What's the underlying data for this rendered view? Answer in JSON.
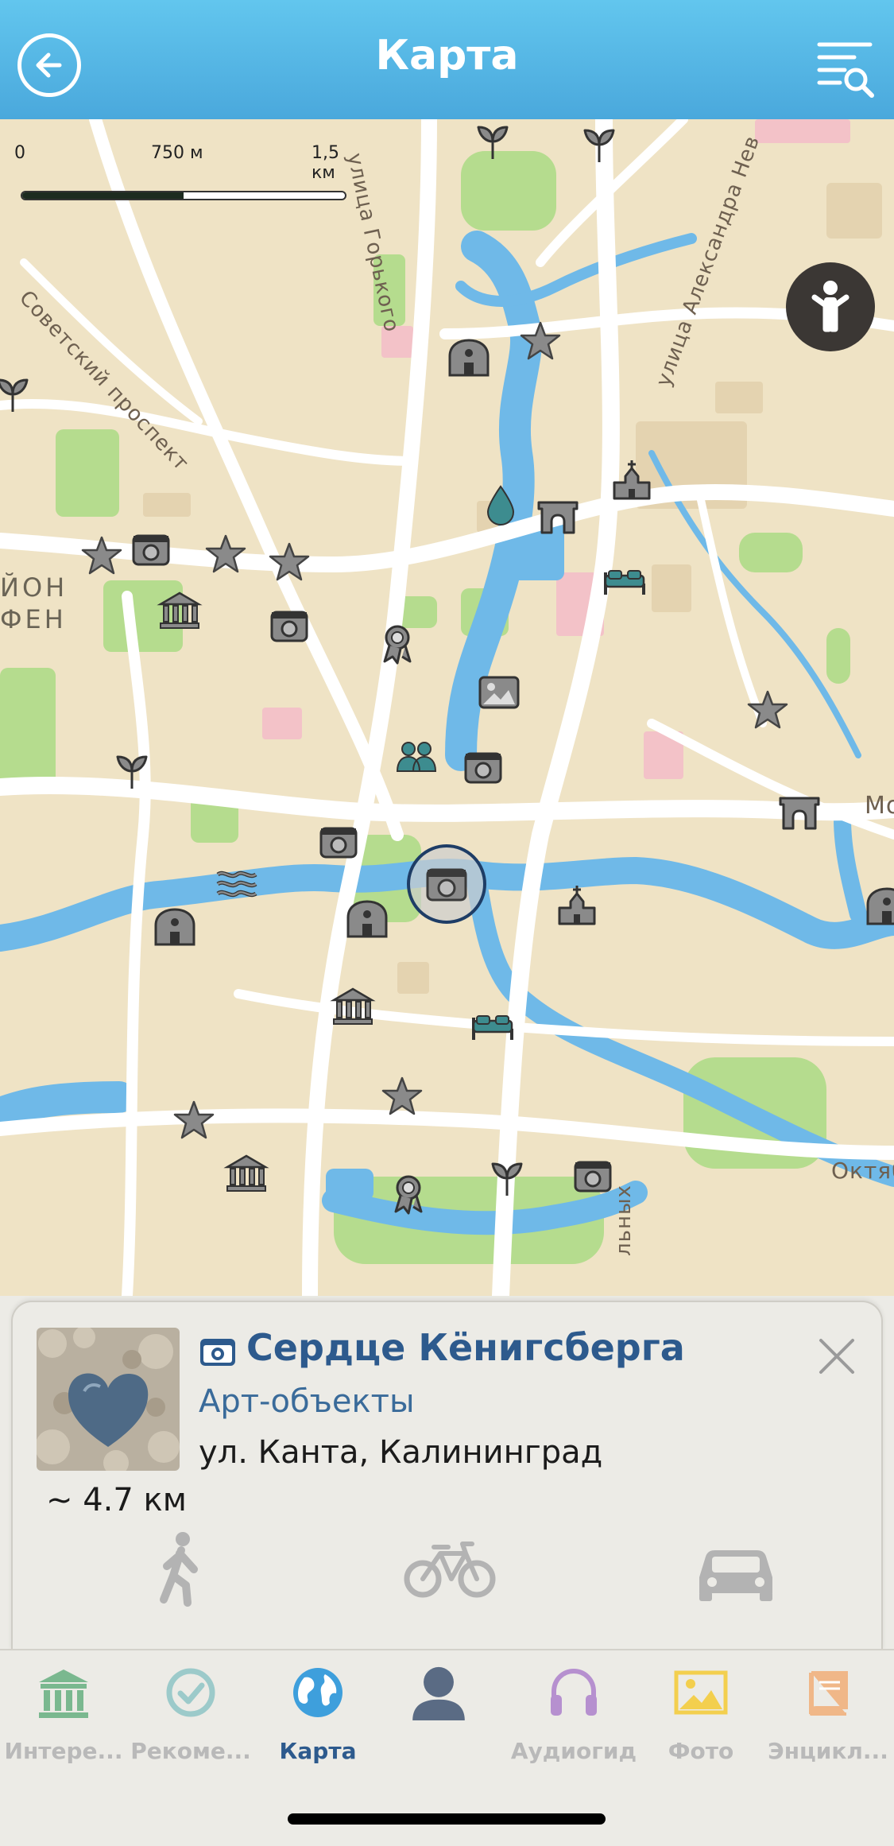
{
  "header": {
    "title": "Карта"
  },
  "map": {
    "scale": {
      "zero": "0",
      "mid": "750 м",
      "max": "1,5 км",
      "fill_fraction": 0.5
    },
    "streets": [
      "Советский проспект",
      "улица Горького",
      "улица Александра Нев",
      "ЙОН",
      "ФЕН",
      "Мо",
      "Октяб",
      "льных"
    ],
    "colors": {
      "land": "#efe3c5",
      "water": "#6fb9e8",
      "park": "#b5dc8e",
      "road": "#ffffff",
      "marker": "#8a8a8a",
      "hotel_marker": "#3d8c8f"
    }
  },
  "card": {
    "title": "Сердце Кёнигсберга",
    "category": "Арт-объекты",
    "address": "ул. Канта, Калининград",
    "distance": "~ 4.7 км",
    "icon": "camera-icon",
    "transport": [
      "walk-icon",
      "bike-icon",
      "car-icon"
    ]
  },
  "tabs": [
    {
      "label": "Интере...",
      "icon": "museum-icon",
      "color": "#7ab88f"
    },
    {
      "label": "Рекоме...",
      "icon": "check-circle-icon",
      "color": "#9ccaca"
    },
    {
      "label": "Карта",
      "icon": "globe-icon",
      "color": "#3e9fdc",
      "active": true
    },
    {
      "label": "",
      "icon": "profile-icon",
      "color": "#5a6b84"
    },
    {
      "label": "Аудиогид",
      "icon": "headphones-icon",
      "color": "#b690cf"
    },
    {
      "label": "Фото",
      "icon": "photo-icon",
      "color": "#f3cf4e"
    },
    {
      "label": "Энцикл...",
      "icon": "book-icon",
      "color": "#f0b788"
    }
  ]
}
